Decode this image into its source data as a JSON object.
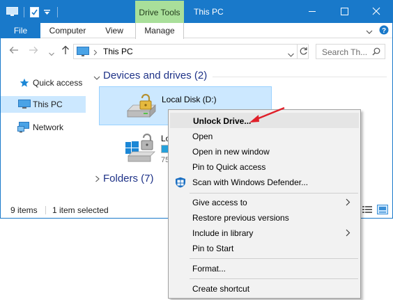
{
  "window": {
    "title": "This PC",
    "context_group": "Drive Tools",
    "controls": [
      "minimize-icon",
      "maximize-icon",
      "close-icon"
    ]
  },
  "ribbon": {
    "tabs": [
      {
        "label": "File"
      },
      {
        "label": "Computer"
      },
      {
        "label": "View"
      },
      {
        "label": "Manage"
      }
    ]
  },
  "address": {
    "path": "This PC",
    "search_placeholder": "Search Th..."
  },
  "navpane": {
    "items": [
      {
        "label": "Quick access",
        "icon": "star-icon"
      },
      {
        "label": "This PC",
        "icon": "computer-icon",
        "selected": true
      },
      {
        "label": "Network",
        "icon": "network-icon"
      }
    ]
  },
  "content": {
    "devices_header": "Devices and drives (2)",
    "folders_header": "Folders (7)",
    "drives": [
      {
        "label": "Local Disk (D:)",
        "icon": "locked-drive-icon",
        "selected": true
      },
      {
        "label": "Lo",
        "sub": "75",
        "icon": "windows-locked-drive-icon"
      }
    ]
  },
  "status": {
    "items": "9 items",
    "selected": "1 item selected"
  },
  "context_menu": {
    "items": [
      {
        "label": "Unlock Drive...",
        "bold": true,
        "hot": true
      },
      {
        "label": "Open"
      },
      {
        "label": "Open in new window"
      },
      {
        "label": "Pin to Quick access"
      },
      {
        "label": "Scan with Windows Defender...",
        "icon": "defender-icon"
      },
      {
        "label": "Give access to",
        "submenu": true
      },
      {
        "label": "Restore previous versions"
      },
      {
        "label": "Include in library",
        "submenu": true
      },
      {
        "label": "Pin to Start"
      },
      {
        "label": "Format..."
      },
      {
        "label": "Create shortcut"
      }
    ]
  },
  "colors": {
    "title_bar": "#1979ca",
    "context_tab": "#a9df9a",
    "selection": "#cce8ff",
    "annotation_arrow": "#e0202a"
  }
}
